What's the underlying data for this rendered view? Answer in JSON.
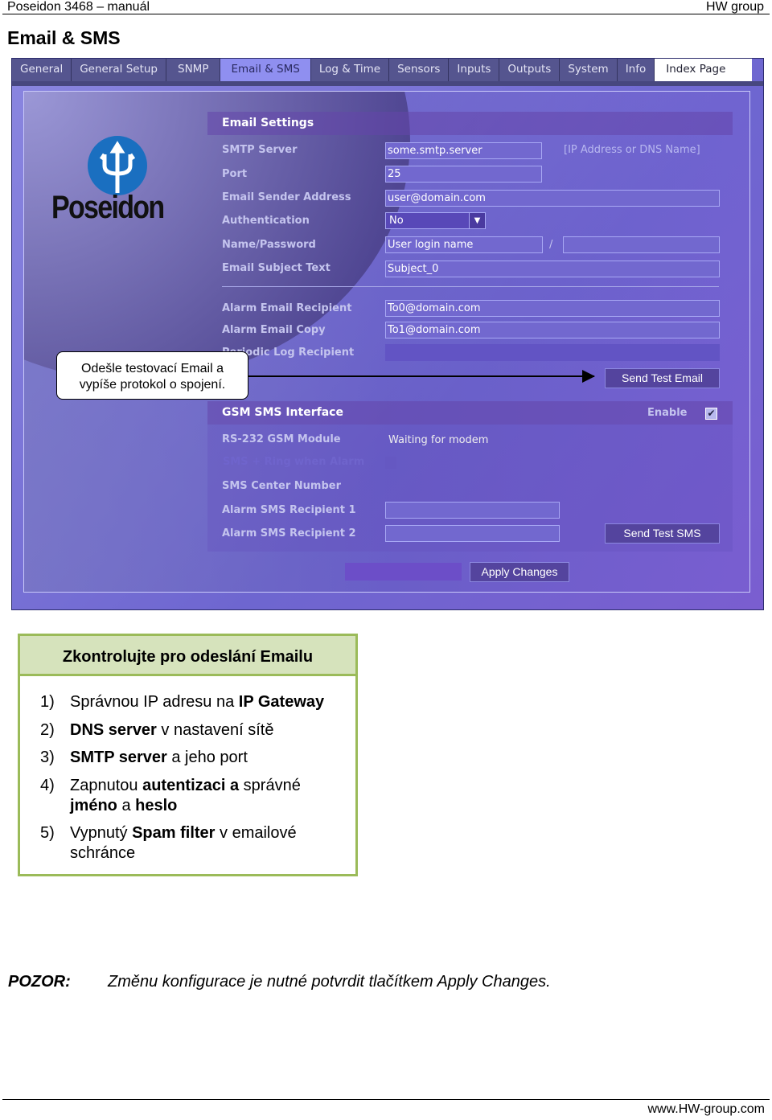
{
  "header": {
    "left": "Poseidon 3468 – manuál",
    "right": "HW group"
  },
  "title": "Email & SMS",
  "screenshot": {
    "tabs": [
      "General",
      "General Setup",
      "SNMP",
      "Email & SMS",
      "Log & Time",
      "Sensors",
      "Inputs",
      "Outputs",
      "System",
      "Info"
    ],
    "active_tab": "Email & SMS",
    "index_page": "Index Page",
    "logo": "Poseidon",
    "email": {
      "title": "Email Settings",
      "smtp_label": "SMTP Server",
      "smtp_value": "some.smtp.server",
      "smtp_hint": "[IP Address or  DNS Name]",
      "port_label": "Port",
      "port_value": "25",
      "sender_label": "Email Sender Address",
      "sender_value": "user@domain.com",
      "auth_label": "Authentication",
      "auth_value": "No",
      "name_label": "Name/Password",
      "name_value": "User login name",
      "slash": "/",
      "password_value": "",
      "subject_label": "Email Subject Text",
      "subject_value": "Subject_0",
      "recipient_label": "Alarm Email Recipient",
      "recipient_value": "To0@domain.com",
      "copy_label": "Alarm Email Copy",
      "copy_value": "To1@domain.com",
      "log_label": "Periodic Log Recipient",
      "log_value": "",
      "send_test": "Send Test Email"
    },
    "sms": {
      "title": "GSM SMS Interface",
      "enable_label": "Enable",
      "enabled": true,
      "module_label": "RS-232 GSM Module",
      "module_value": "Waiting for modem",
      "ring_label": "SMS + Ring when Alarm",
      "center_label": "SMS Center Number",
      "r1_label": "Alarm SMS Recipient 1",
      "r1_value": "",
      "r2_label": "Alarm SMS Recipient 2",
      "r2_value": "",
      "send_test": "Send Test SMS"
    },
    "apply": "Apply Changes"
  },
  "callout": {
    "line1": "Odešle testovací Email a",
    "line2": "vypíše protokol o spojení."
  },
  "checklist": {
    "title": "Zkontrolujte pro odeslání Emailu",
    "items": [
      {
        "n": "1)",
        "parts": [
          "Správnou IP adresu na ",
          "IP Gateway",
          ""
        ]
      },
      {
        "n": "2)",
        "parts": [
          "",
          "DNS server",
          " v nastavení sítě"
        ]
      },
      {
        "n": "3)",
        "parts": [
          "",
          "SMTP server",
          " a jeho port"
        ]
      },
      {
        "n": "4)",
        "parts": [
          "Zapnutou ",
          "autentizaci a",
          " správné "
        ],
        "extra": [
          "jméno",
          " a ",
          "heslo"
        ]
      },
      {
        "n": "5)",
        "parts": [
          "Vypnutý ",
          "Spam filter",
          " v emailové schránce"
        ]
      }
    ]
  },
  "note": {
    "label": "POZOR:",
    "text": "Změnu konfigurace je nutné potvrdit tlačítkem Apply Changes."
  },
  "footer": "www.HW-group.com"
}
